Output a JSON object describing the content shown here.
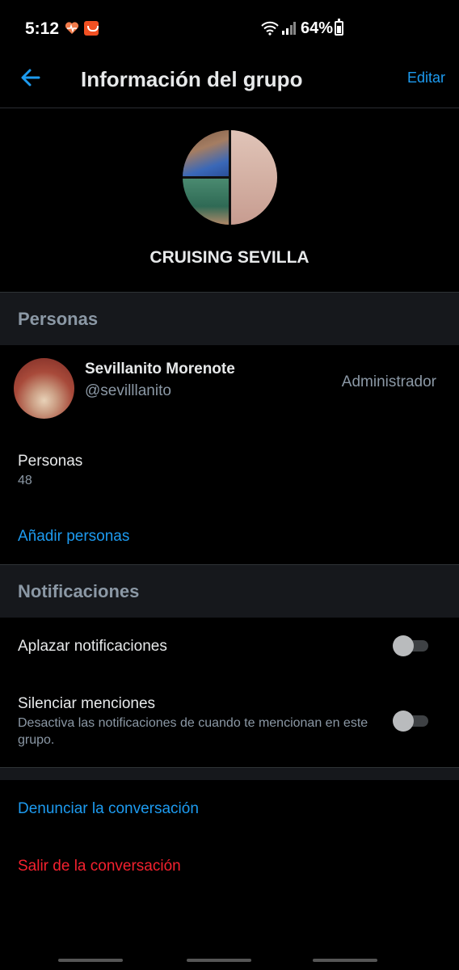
{
  "status_bar": {
    "time": "5:12",
    "battery": "64%",
    "icons": [
      "heart-icon",
      "shop-icon",
      "wifi-icon",
      "signal-icon",
      "battery-icon"
    ]
  },
  "header": {
    "title": "Información del grupo",
    "edit_label": "Editar",
    "back_icon": "arrow-left-icon"
  },
  "group": {
    "name": "CRUISING SEVILLA"
  },
  "people_section": {
    "title": "Personas",
    "member": {
      "name": "Sevillanito Morenote",
      "handle": "@sevilllanito",
      "role": "Administrador"
    },
    "people_label": "Personas",
    "people_count": "48",
    "add_label": "Añadir personas"
  },
  "notifications_section": {
    "title": "Notificaciones",
    "snooze_label": "Aplazar notificaciones",
    "snooze_enabled": false,
    "mute_mentions_label": "Silenciar menciones",
    "mute_mentions_desc": "Desactiva las notificaciones de cuando te mencionan en este grupo.",
    "mute_mentions_enabled": false
  },
  "actions": {
    "report_label": "Denunciar la conversación",
    "leave_label": "Salir de la conversación"
  },
  "colors": {
    "accent": "#1d9bf0",
    "danger": "#f4212e",
    "background": "#000000",
    "section_bg": "#16181c",
    "secondary_text": "#8b98a5"
  }
}
